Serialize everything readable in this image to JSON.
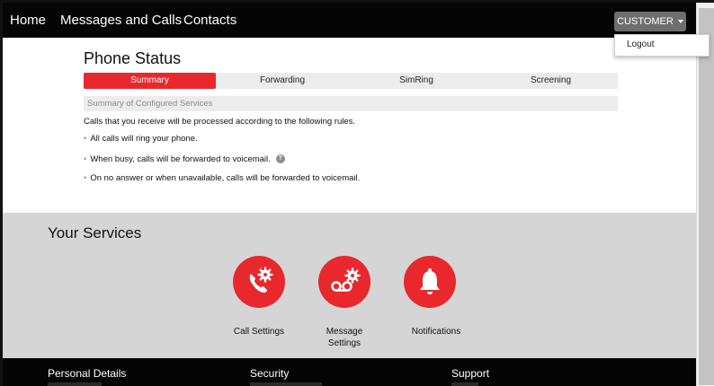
{
  "nav": {
    "links": [
      "Home",
      "Messages and Calls",
      "Contacts"
    ],
    "user_button": "CUSTOMER",
    "dropdown_item": "Logout"
  },
  "phone_status": {
    "title": "Phone Status",
    "tabs": [
      "Summary",
      "Forwarding",
      "SimRing",
      "Screening"
    ],
    "active_tab": "Summary",
    "summary_header": "Summary of Configured Services",
    "intro": "Calls that you receive will be processed according to the following rules.",
    "rules": [
      "All calls will ring your phone.",
      "When busy, calls will be forwarded to voicemail.",
      "On no answer or when unavailable, calls will be forwarded to voicemail."
    ],
    "help_glyph": "?"
  },
  "services": {
    "title": "Your Services",
    "items": [
      {
        "label": "Call Settings",
        "icon": "phone-gear-icon"
      },
      {
        "label": "Message Settings",
        "icon": "voicemail-gear-icon"
      },
      {
        "label": "Notifications",
        "icon": "bell-icon"
      }
    ]
  },
  "footer": {
    "headings": [
      "Personal Details",
      "Security",
      "Support"
    ]
  },
  "colors": {
    "accent": "#e8282d",
    "navbar": "#050505",
    "services_bg": "#d5d5d5"
  }
}
